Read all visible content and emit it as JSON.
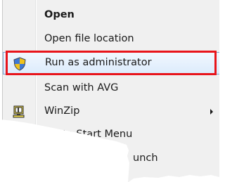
{
  "context_menu": {
    "items": [
      {
        "label": "Open",
        "bold": true,
        "icon": "",
        "has_submenu": false
      },
      {
        "label": "Open file location",
        "bold": false,
        "icon": "",
        "has_submenu": false
      },
      {
        "label": "Run as administrator",
        "bold": false,
        "icon": "uac-shield-icon",
        "has_submenu": false,
        "highlighted": true
      },
      {
        "label": "Scan with AVG",
        "bold": false,
        "icon": "",
        "has_submenu": false
      },
      {
        "label": "WinZip",
        "bold": false,
        "icon": "winzip-icon",
        "has_submenu": true
      },
      {
        "label": "Pin to Start Menu",
        "bold": false,
        "icon": "",
        "has_submenu": false
      },
      {
        "label": "unch",
        "bold": false,
        "icon": "",
        "has_submenu": false
      }
    ],
    "highlight_color": "#e8141b",
    "hover_border_color": "#7da2ce"
  }
}
